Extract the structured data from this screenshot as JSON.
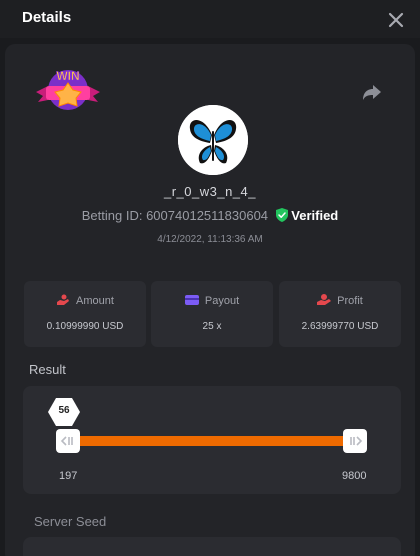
{
  "header": {
    "title": "Details"
  },
  "icons": {
    "close": "close-icon",
    "share": "share-icon",
    "win": "win-badge-icon",
    "avatar": "butterfly-avatar",
    "verified": "shield-check-icon",
    "amount": "coins-hand-icon",
    "payout": "wallet-icon",
    "profit": "profit-hand-icon",
    "handle": "slider-handle-icon"
  },
  "badge": {
    "text": "WIN"
  },
  "user": {
    "username": "_r_0_w3_n_4_",
    "betting_id_label": "Betting ID:",
    "betting_id": "60074012511830604",
    "verified": "Verified",
    "date": "4/12/2022, 11:13:36 AM"
  },
  "stats": {
    "amount": {
      "label": "Amount",
      "value": "0.10999990 USD"
    },
    "payout": {
      "label": "Payout",
      "value": "25 x"
    },
    "profit": {
      "label": "Profit",
      "value": "2.63999770 USD"
    }
  },
  "result": {
    "label": "Result",
    "marker": "56",
    "min": "197",
    "max": "9800"
  },
  "server_seed": {
    "label": "Server Seed"
  },
  "colors": {
    "accent": "#ee6a00",
    "verified": "#22c55e",
    "stat_icon_red": "#e5484d",
    "stat_icon_purple": "#7c5cf5",
    "background": "#1a1b1e",
    "card": "#2b2c31"
  }
}
